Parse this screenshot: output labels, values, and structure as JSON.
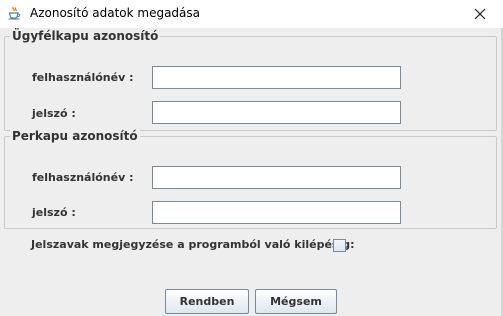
{
  "window": {
    "title": "Azonosító adatok megadása",
    "app_icon": "java-cup-icon",
    "close_icon": "close-icon"
  },
  "ugyfelkapu": {
    "legend": "Ügyfélkapu azonosító",
    "username_label": "felhasználónév :",
    "username_value": "",
    "password_label": "jelszó :",
    "password_value": ""
  },
  "perkapu": {
    "legend": "Perkapu azonosító",
    "username_label": "felhasználónév :",
    "username_value": "",
    "password_label": "jelszó :",
    "password_value": ""
  },
  "remember": {
    "label": "Jelszavak megjegyzése a programból való kilépésig:",
    "checked": false
  },
  "buttons": {
    "ok": "Rendben",
    "cancel": "Mégsem"
  }
}
